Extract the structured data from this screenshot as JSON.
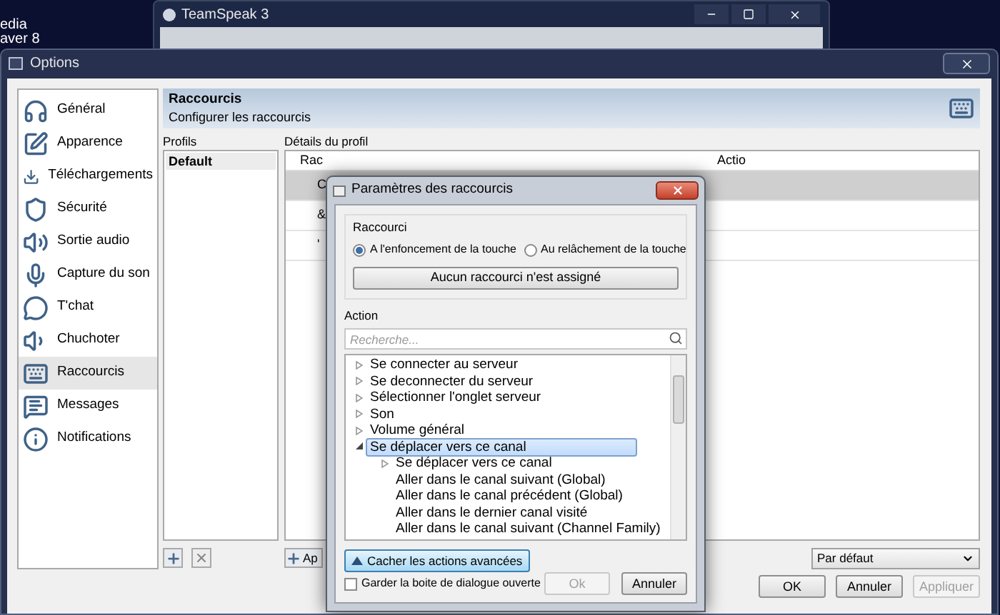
{
  "desktop": {
    "labels": [
      "edia",
      "aver 8"
    ]
  },
  "background_window": {
    "title": "TeamSpeak 3"
  },
  "window": {
    "title": "Options"
  },
  "sidebar": {
    "items": [
      {
        "label": "Général",
        "selected": false
      },
      {
        "label": "Apparence",
        "selected": false
      },
      {
        "label": "Téléchargements",
        "selected": false
      },
      {
        "label": "Sécurité",
        "selected": false
      },
      {
        "label": "Sortie audio",
        "selected": false
      },
      {
        "label": "Capture du son",
        "selected": false
      },
      {
        "label": "T'chat",
        "selected": false
      },
      {
        "label": "Chuchoter",
        "selected": false
      },
      {
        "label": "Raccourcis",
        "selected": true
      },
      {
        "label": "Messages",
        "selected": false
      },
      {
        "label": "Notifications",
        "selected": false
      }
    ]
  },
  "header": {
    "title": "Raccourcis",
    "subtitle": "Configurer les raccourcis"
  },
  "profiles": {
    "label": "Profils",
    "items": [
      {
        "name": "Default",
        "selected": true
      }
    ]
  },
  "details": {
    "label": "Détails du profil",
    "columns": [
      "Rac",
      "Actio"
    ],
    "rows": [
      {
        "cells": [
          "C"
        ],
        "selected": true
      },
      {
        "cells": [
          "&"
        ],
        "selected": false
      },
      {
        "cells": [
          "'"
        ],
        "selected": false
      }
    ],
    "add_button": "Ap"
  },
  "preset_select": {
    "value": "Par défaut"
  },
  "buttons": [
    {
      "label": "OK",
      "disabled": false
    },
    {
      "label": "Annuler",
      "disabled": false
    },
    {
      "label": "Appliquer",
      "disabled": true
    }
  ],
  "dialog": {
    "title": "Paramètres des raccourcis",
    "shortcut_group": {
      "label": "Raccourci",
      "options": [
        {
          "label": "A l'enfoncement de la touche",
          "selected": true
        },
        {
          "label": "Au relâchement de la touche",
          "selected": false
        }
      ],
      "assign_button": "Aucun raccourci n'est assigné"
    },
    "action_group": {
      "label": "Action",
      "search": {
        "placeholder": "Recherche..."
      },
      "tree": [
        {
          "label": "Se connecter au serveur",
          "expanded": false,
          "selected": false
        },
        {
          "label": "Se deconnecter du serveur",
          "expanded": false,
          "selected": false
        },
        {
          "label": "Sélectionner l'onglet serveur",
          "expanded": false,
          "selected": false
        },
        {
          "label": "Son",
          "expanded": false,
          "selected": false
        },
        {
          "label": "Volume général",
          "expanded": false,
          "selected": false
        },
        {
          "label": "Se déplacer vers ce canal",
          "expanded": true,
          "selected": true,
          "children": [
            {
              "label": "Se déplacer vers ce canal",
              "expanded": false,
              "selected": false
            },
            {
              "label": "Aller dans le canal suivant (Global)",
              "selected": false
            },
            {
              "label": "Aller dans le canal précédent (Global)",
              "selected": false
            },
            {
              "label": "Aller dans le dernier canal visité",
              "selected": false
            },
            {
              "label": "Aller dans le canal suivant (Channel Family)",
              "selected": false
            }
          ]
        }
      ],
      "toggle_button": "Cacher les actions avancées"
    },
    "keep_open": {
      "label": "Garder la boite de dialogue ouverte",
      "checked": false
    },
    "buttons": [
      {
        "label": "Ok",
        "disabled": true
      },
      {
        "label": "Annuler",
        "disabled": false
      }
    ]
  }
}
